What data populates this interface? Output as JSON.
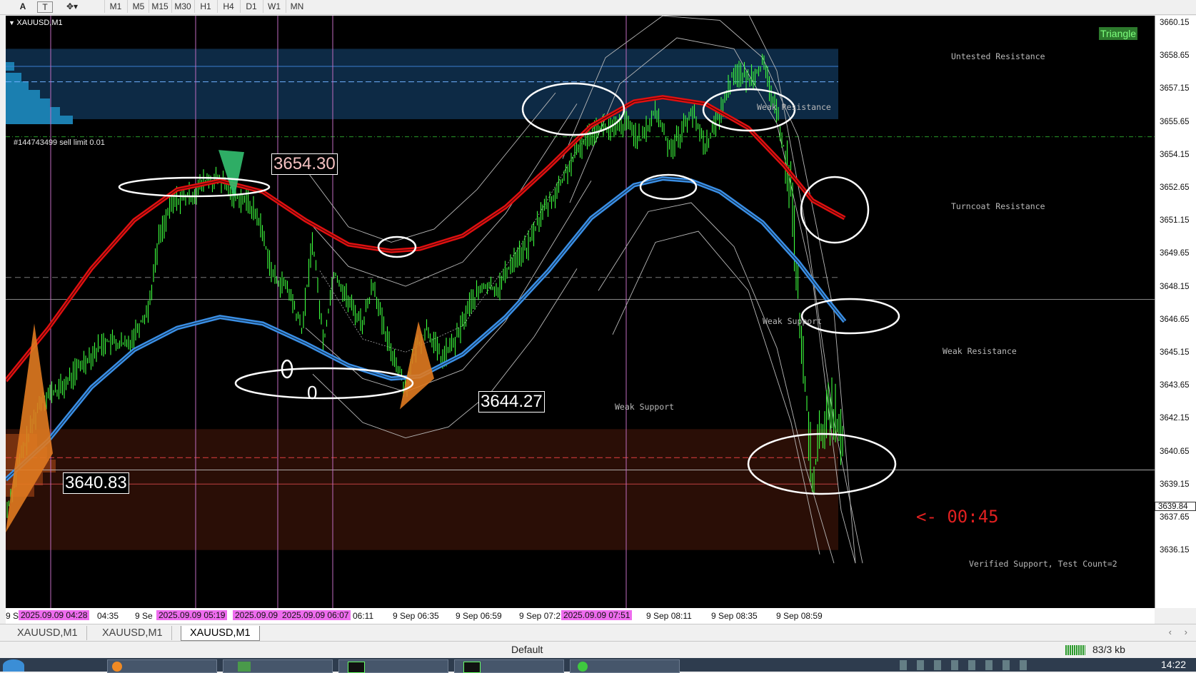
{
  "toolbar": {
    "tool_text": "A",
    "tool_label": "T",
    "timeframes": [
      "M1",
      "M5",
      "M15",
      "M30",
      "H1",
      "H4",
      "D1",
      "W1",
      "MN"
    ]
  },
  "chart": {
    "symbol_title": "XAUUSD,M1",
    "pattern_badge": "Triangle",
    "order_label": "#144743499 sell limit 0.01",
    "price_labels": {
      "label_3654": "3654.30",
      "label_3644": "3644.27",
      "label_3640": "3640.83",
      "current": "3639.84"
    },
    "zone_labels": {
      "untested_resistance": "Untested Resistance",
      "weak_resistance_top": "Weak Resistance",
      "turncoat_resistance": "Turncoat Resistance",
      "weak_support_mid": "Weak Support",
      "weak_resistance_right": "Weak Resistance",
      "weak_support_low": "Weak Support",
      "verified_support": "Verified Support, Test Count=2"
    },
    "digit_mark": "0",
    "timer": "<- 00:45",
    "colors": {
      "candles": "#3dff3d",
      "upper_ma": "#e01010",
      "lower_ma": "#3a8fe6",
      "resistance_zone": "#0d2a45",
      "support_zone": "#2a0e06"
    }
  },
  "chart_data": {
    "type": "candlestick",
    "symbol": "XAUUSD",
    "timeframe": "M1",
    "y_ticks": [
      3660.15,
      3658.65,
      3657.15,
      3655.65,
      3654.15,
      3652.65,
      3651.15,
      3649.65,
      3648.15,
      3646.65,
      3645.15,
      3643.65,
      3642.15,
      3640.65,
      3639.15,
      3637.65,
      3636.15
    ],
    "current_price": 3639.84,
    "x_ticks": [
      "9 S",
      "2025.09.09 04:28",
      "04:35",
      "9 Se",
      "2025.09.09 05:19",
      "2025.09.09 (",
      "2025.09.09 06:07",
      "06:11",
      "9 Sep 06:35",
      "9 Sep 06:59",
      "9 Sep 07:2",
      "2025.09.09 07:51",
      "9 Sep 08:11",
      "9 Sep 08:35",
      "9 Sep 08:59"
    ],
    "ylim": [
      3635.5,
      3660.5
    ],
    "close_path": [
      [
        0,
        3637.8
      ],
      [
        20,
        3640.3
      ],
      [
        50,
        3643.1
      ],
      [
        80,
        3643.6
      ],
      [
        110,
        3644.8
      ],
      [
        140,
        3645.7
      ],
      [
        170,
        3645.5
      ],
      [
        200,
        3647.2
      ],
      [
        215,
        3650.5
      ],
      [
        235,
        3652.1
      ],
      [
        260,
        3652.3
      ],
      [
        280,
        3653.0
      ],
      [
        300,
        3653.0
      ],
      [
        320,
        3652.4
      ],
      [
        340,
        3652.0
      ],
      [
        355,
        3651.2
      ],
      [
        375,
        3648.6
      ],
      [
        395,
        3648.1
      ],
      [
        415,
        3646.2
      ],
      [
        430,
        3650.4
      ],
      [
        445,
        3645.6
      ],
      [
        460,
        3648.9
      ],
      [
        480,
        3647.5
      ],
      [
        500,
        3646.5
      ],
      [
        515,
        3648.4
      ],
      [
        530,
        3646.1
      ],
      [
        545,
        3644.9
      ],
      [
        560,
        3643.6
      ],
      [
        575,
        3645.4
      ],
      [
        590,
        3646.3
      ],
      [
        610,
        3644.9
      ],
      [
        630,
        3645.7
      ],
      [
        650,
        3647.4
      ],
      [
        670,
        3648.2
      ],
      [
        690,
        3648.1
      ],
      [
        710,
        3649.4
      ],
      [
        730,
        3649.9
      ],
      [
        750,
        3651.5
      ],
      [
        770,
        3652.4
      ],
      [
        790,
        3653.7
      ],
      [
        810,
        3654.8
      ],
      [
        830,
        3655.5
      ],
      [
        850,
        3655.3
      ],
      [
        870,
        3655.6
      ],
      [
        890,
        3654.8
      ],
      [
        910,
        3656.2
      ],
      [
        930,
        3654.5
      ],
      [
        945,
        3655.1
      ],
      [
        960,
        3656.2
      ],
      [
        980,
        3654.6
      ],
      [
        1000,
        3656.0
      ],
      [
        1020,
        3658.0
      ],
      [
        1040,
        3657.6
      ],
      [
        1060,
        3658.3
      ],
      [
        1070,
        3657.2
      ],
      [
        1085,
        3655.4
      ],
      [
        1100,
        3652.6
      ],
      [
        1115,
        3645.3
      ],
      [
        1130,
        3639.4
      ],
      [
        1145,
        3642.0
      ],
      [
        1160,
        3642.6
      ],
      [
        1175,
        3640.4
      ]
    ],
    "series": [
      {
        "name": "upper_ma",
        "points": [
          [
            0,
            3643.9
          ],
          [
            60,
            3646.3
          ],
          [
            120,
            3649.0
          ],
          [
            180,
            3651.2
          ],
          [
            240,
            3652.6
          ],
          [
            300,
            3653.0
          ],
          [
            360,
            3652.5
          ],
          [
            420,
            3651.2
          ],
          [
            480,
            3650.1
          ],
          [
            540,
            3649.8
          ],
          [
            580,
            3649.9
          ],
          [
            640,
            3650.5
          ],
          [
            700,
            3651.8
          ],
          [
            760,
            3653.6
          ],
          [
            820,
            3655.5
          ],
          [
            880,
            3656.6
          ],
          [
            920,
            3656.8
          ],
          [
            980,
            3656.5
          ],
          [
            1040,
            3655.4
          ],
          [
            1090,
            3653.7
          ],
          [
            1130,
            3652.1
          ],
          [
            1175,
            3651.3
          ]
        ]
      },
      {
        "name": "lower_ma",
        "points": [
          [
            0,
            3639.4
          ],
          [
            60,
            3641.2
          ],
          [
            120,
            3643.6
          ],
          [
            180,
            3645.3
          ],
          [
            240,
            3646.3
          ],
          [
            300,
            3646.8
          ],
          [
            360,
            3646.5
          ],
          [
            420,
            3645.6
          ],
          [
            480,
            3644.6
          ],
          [
            540,
            3644.0
          ],
          [
            580,
            3644.1
          ],
          [
            640,
            3645.1
          ],
          [
            700,
            3646.8
          ],
          [
            760,
            3648.9
          ],
          [
            820,
            3651.3
          ],
          [
            880,
            3652.8
          ],
          [
            920,
            3653.1
          ],
          [
            960,
            3653.0
          ],
          [
            1000,
            3652.5
          ],
          [
            1060,
            3651.1
          ],
          [
            1110,
            3649.3
          ],
          [
            1150,
            3647.6
          ],
          [
            1175,
            3646.6
          ]
        ]
      }
    ],
    "zones": [
      {
        "name": "resistance",
        "from": 3655.8,
        "to": 3659.0
      },
      {
        "name": "support",
        "from": 3636.2,
        "to": 3641.7
      }
    ],
    "pattern": "Triangle"
  },
  "tabs": [
    "XAUUSD,M1",
    "XAUUSD,M1",
    "XAUUSD,M1"
  ],
  "status": {
    "profile": "Default",
    "traffic": "83/3 kb"
  },
  "taskbar": {
    "clock": "14:22"
  }
}
